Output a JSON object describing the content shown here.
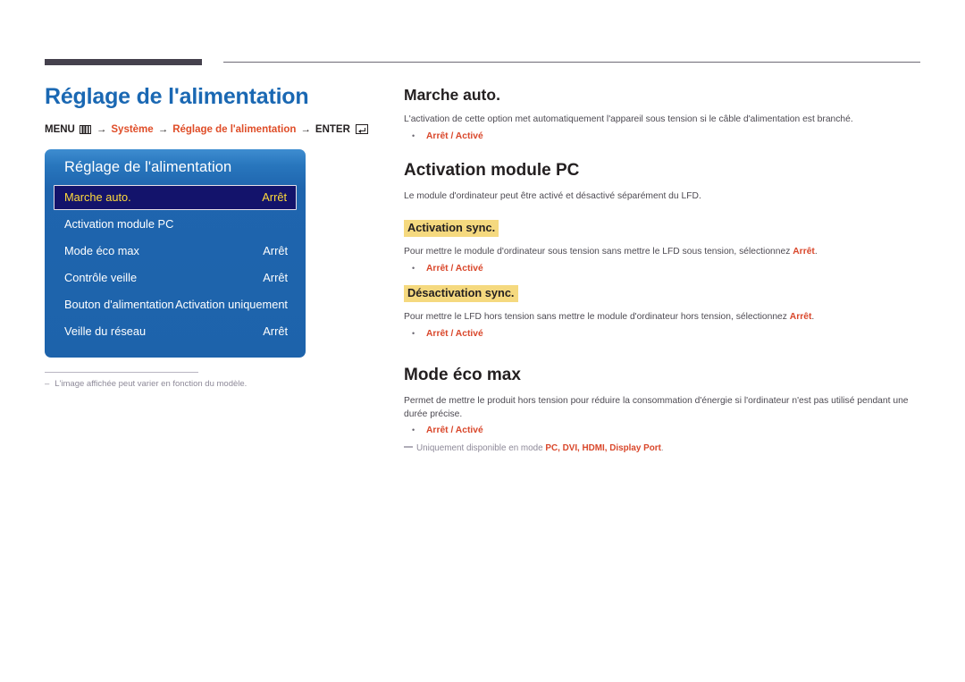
{
  "page": {
    "title": "Réglage de l'alimentation",
    "accent_blue": "#1a68b3",
    "accent_orange": "#df4d28",
    "highlight_yellow": "#f5d97f"
  },
  "breadcrumb": {
    "menu_label": "MENU",
    "menu_icon": "menu-bars-icon",
    "arrow": "→",
    "item1": "Système",
    "item2": "Réglage de l'alimentation",
    "enter_label": "ENTER",
    "enter_icon": "enter-key-icon"
  },
  "osd": {
    "title": "Réglage de l'alimentation",
    "rows": [
      {
        "label": "Marche auto.",
        "value": "Arrêt",
        "selected": true
      },
      {
        "label": "Activation module PC",
        "value": "",
        "selected": false
      },
      {
        "label": "Mode éco max",
        "value": "Arrêt",
        "selected": false
      },
      {
        "label": "Contrôle veille",
        "value": "Arrêt",
        "selected": false
      },
      {
        "label": "Bouton d'alimentation",
        "value": "Activation uniquement",
        "selected": false
      },
      {
        "label": "Veille du réseau",
        "value": "Arrêt",
        "selected": false
      }
    ]
  },
  "left_note": {
    "dash": "–",
    "text": "L'image affichée peut varier en fonction du modèle."
  },
  "sections": {
    "marche_auto": {
      "heading": "Marche auto.",
      "paragraph": "L'activation de cette option met automatiquement l'appareil sous tension si le câble d'alimentation est branché.",
      "bullet": "Arrêt / Activé"
    },
    "activation_module_pc": {
      "heading": "Activation module PC",
      "paragraph": "Le module d'ordinateur peut être activé et désactivé séparément du LFD.",
      "sub1": {
        "heading": "Activation sync.",
        "paragraph_pre": "Pour mettre le module d'ordinateur sous tension sans mettre le LFD sous tension, sélectionnez ",
        "paragraph_hl": "Arrêt",
        "paragraph_post": ".",
        "bullet": "Arrêt / Activé"
      },
      "sub2": {
        "heading": "Désactivation sync.",
        "paragraph_pre": "Pour mettre le LFD hors tension sans mettre le module d'ordinateur hors tension, sélectionnez ",
        "paragraph_hl": "Arrêt",
        "paragraph_post": ".",
        "bullet": "Arrêt / Activé"
      }
    },
    "mode_eco_max": {
      "heading": "Mode éco max",
      "paragraph": "Permet de mettre le produit hors tension pour réduire la consommation d'énergie si l'ordinateur n'est pas utilisé pendant une durée précise.",
      "bullet": "Arrêt / Activé",
      "note_pre": "Uniquement disponible en mode ",
      "note_modes": "PC, DVI, HDMI, Display Port",
      "note_post": "."
    }
  }
}
